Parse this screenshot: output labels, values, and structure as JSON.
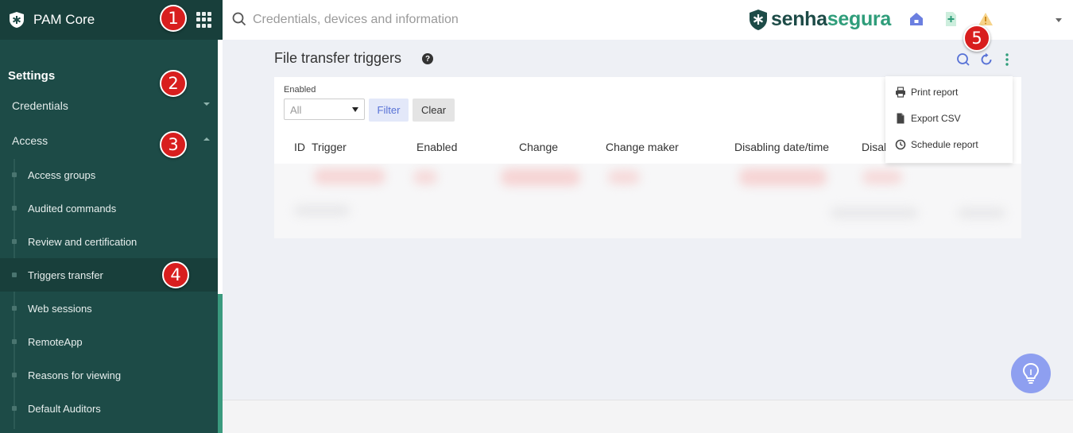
{
  "sidebar": {
    "app_name": "PAM Core",
    "section_title": "Settings",
    "groups": [
      {
        "label": "Credentials",
        "expanded": false
      },
      {
        "label": "Access",
        "expanded": true
      }
    ],
    "items": [
      {
        "label": "Access groups",
        "active": false
      },
      {
        "label": "Audited commands",
        "active": false
      },
      {
        "label": "Review and certification",
        "active": false
      },
      {
        "label": "Triggers transfer",
        "active": true
      },
      {
        "label": "Web sessions",
        "active": false
      },
      {
        "label": "RemoteApp",
        "active": false
      },
      {
        "label": "Reasons for viewing",
        "active": false
      },
      {
        "label": "Default Auditors",
        "active": false
      }
    ]
  },
  "topbar": {
    "search_placeholder": "Credentials, devices and information",
    "brand_part1": "senha",
    "brand_part2": "segura",
    "icons": [
      "home-icon",
      "new-document-icon",
      "warning-icon",
      "user-dropdown-icon"
    ]
  },
  "page": {
    "title": "File transfer triggers",
    "actions": [
      "search-icon",
      "refresh-icon",
      "more-options-icon"
    ]
  },
  "filter": {
    "label": "Enabled",
    "selected": "All",
    "filter_button": "Filter",
    "clear_button": "Clear"
  },
  "table": {
    "columns": [
      "ID",
      "Trigger",
      "Enabled",
      "Change",
      "Change maker",
      "Disabling date/time",
      "Disabling"
    ]
  },
  "menu": {
    "items": [
      {
        "label": "Print report",
        "icon": "printer-icon"
      },
      {
        "label": "Export CSV",
        "icon": "file-icon"
      },
      {
        "label": "Schedule report",
        "icon": "clock-icon"
      }
    ]
  },
  "annotations": [
    "1",
    "2",
    "3",
    "4",
    "5"
  ],
  "colors": {
    "sidebar_bg": "#1d4b47",
    "sidebar_header_bg": "#183f3b",
    "brand_dark": "#1d4b47",
    "brand_green": "#2f9d7a",
    "accent_blue": "#5872d6",
    "badge_red": "#d81e1e"
  }
}
